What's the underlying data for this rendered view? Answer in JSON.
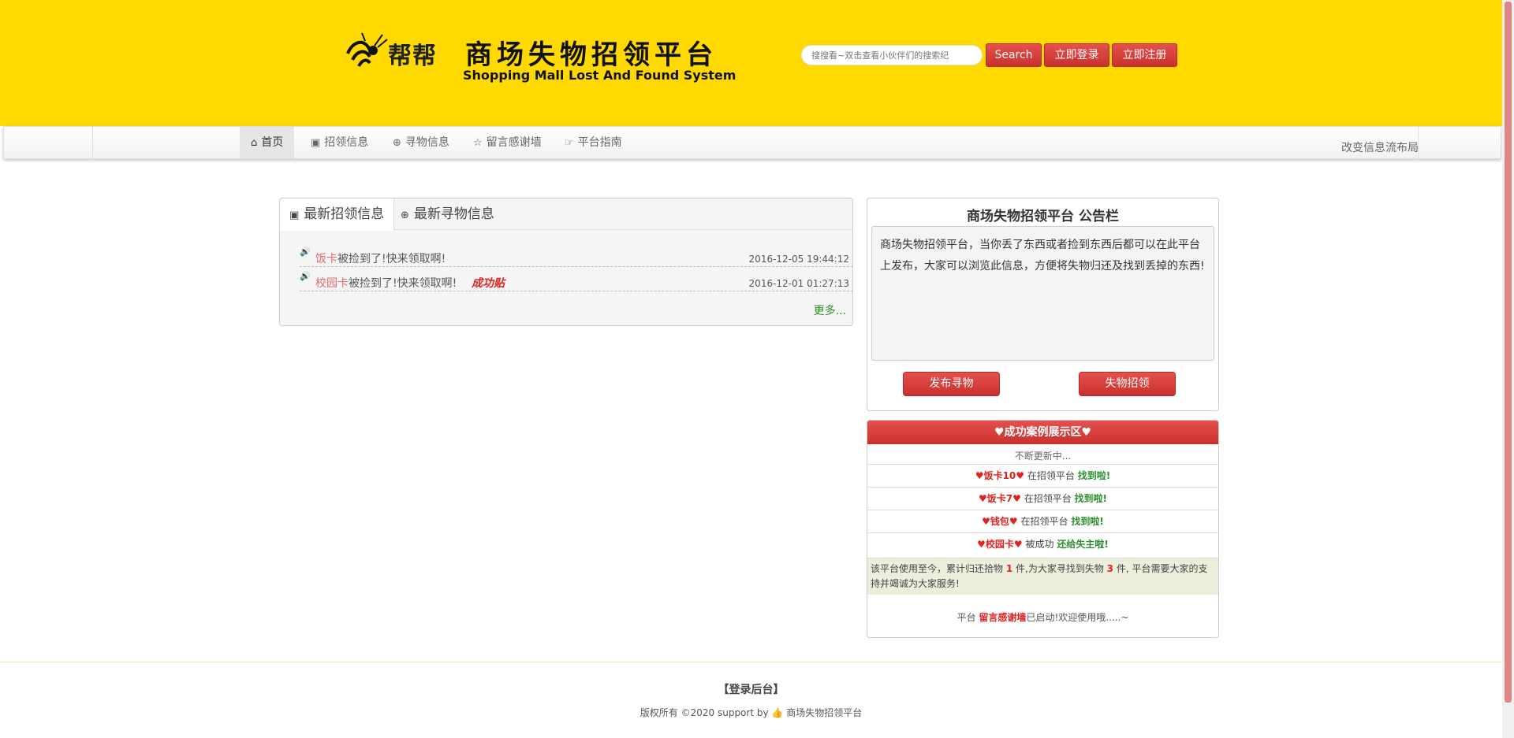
{
  "header": {
    "logo_text": "帮帮",
    "title": "商场失物招领平台",
    "subtitle": "Shopping Mall Lost And Found System",
    "search_placeholder": "搜搜看~双击查看小伙伴们的搜索纪",
    "search_label": "Search",
    "login_label": "立即登录",
    "register_label": "立即注册"
  },
  "nav": {
    "items": [
      {
        "label": "首页",
        "icon": "home-icon",
        "active": true
      },
      {
        "label": "招领信息",
        "icon": "picture-icon"
      },
      {
        "label": "寻物信息",
        "icon": "zoom-in-icon"
      },
      {
        "label": "留言感谢墙",
        "icon": "star-icon"
      },
      {
        "label": "平台指南",
        "icon": "hand-right-icon"
      }
    ],
    "right_text": "改变信息流布局"
  },
  "latest": {
    "tabs": [
      {
        "label": "最新招领信息",
        "icon": "picture-icon",
        "active": true
      },
      {
        "label": "最新寻物信息",
        "icon": "zoom-in-icon"
      }
    ],
    "rows": [
      {
        "item": "饭卡",
        "text": "被捡到了!快来领取啊!",
        "time": "2016-12-05 19:44:12",
        "badge": ""
      },
      {
        "item": "校园卡",
        "text": "被捡到了!快来领取啊!",
        "time": "2016-12-01 01:27:13",
        "badge": "成功贴"
      }
    ],
    "more_label": "更多..."
  },
  "notice": {
    "title": "商场失物招领平台 公告栏",
    "body": "商场失物招领平台，当你丢了东西或者捡到东西后都可以在此平台上发布，大家可以浏览此信息，方便将失物归还及找到丢掉的东西!",
    "btn_lost": "发布寻物",
    "btn_found": "失物招领"
  },
  "cases": {
    "title": "♥成功案例展示区♥",
    "updating": "不断更新中...",
    "rows": [
      {
        "name": "♥饭卡10♥",
        "mid": " 在招领平台 ",
        "end": "找到啦!"
      },
      {
        "name": "♥饭卡7♥",
        "mid": " 在招领平台 ",
        "end": "找到啦!"
      },
      {
        "name": "♥钱包♥",
        "mid": " 在招领平台 ",
        "end": "找到啦!"
      },
      {
        "name": "♥校园卡♥",
        "mid": " 被成功 ",
        "end": "还给失主啦!"
      }
    ],
    "stats": {
      "pre": "该平台使用至今，累计归还拾物 ",
      "returned": "1",
      "mid": " 件,为大家寻找到失物 ",
      "found": "3",
      "post": " 件, 平台需要大家的支持并竭诚为大家服务!"
    },
    "foot": {
      "pre": "平台 ",
      "link": "留言感谢墙",
      "post": "已启动!欢迎使用哦.....~"
    }
  },
  "footer": {
    "admin_label": "【登录后台】",
    "copyright": "版权所有 ©2020 support by",
    "brand": "商场失物招领平台"
  },
  "colors": {
    "header_bg": "#ffd900",
    "button_red": "#d9534f",
    "success_green": "#2d8f2d",
    "highlight_red": "#e0231f"
  }
}
